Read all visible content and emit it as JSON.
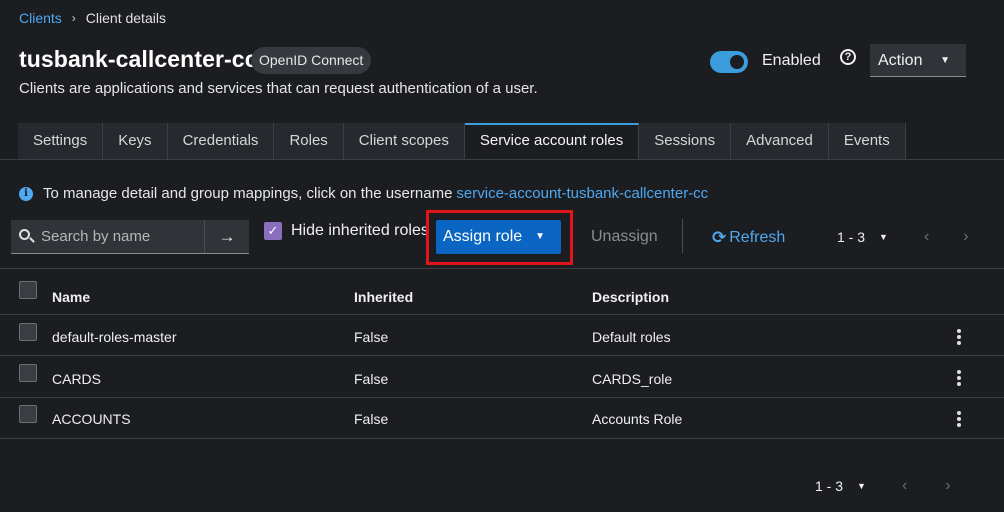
{
  "breadcrumb": {
    "root": "Clients",
    "separator": "›",
    "current": "Client details"
  },
  "header": {
    "title": "tusbank-callcenter-cc",
    "protocol_badge": "OpenID Connect",
    "subtitle": "Clients are applications and services that can request authentication of a user.",
    "enabled_label": "Enabled",
    "enabled": true,
    "help_glyph": "?",
    "action_label": "Action"
  },
  "tabs": [
    {
      "label": "Settings"
    },
    {
      "label": "Keys"
    },
    {
      "label": "Credentials"
    },
    {
      "label": "Roles"
    },
    {
      "label": "Client scopes"
    },
    {
      "label": "Service account roles",
      "active": true
    },
    {
      "label": "Sessions"
    },
    {
      "label": "Advanced"
    },
    {
      "label": "Events"
    }
  ],
  "info": {
    "text": "To manage detail and group mappings, click on the username",
    "link": "service-account-tusbank-callcenter-cc"
  },
  "toolbar": {
    "search_placeholder": "Search by name",
    "hide_inherited_label": "Hide inherited roles",
    "hide_inherited_checked": true,
    "assign_label": "Assign role",
    "unassign_label": "Unassign",
    "refresh_label": "Refresh",
    "pagination": "1 - 3"
  },
  "table": {
    "headers": {
      "name": "Name",
      "inherited": "Inherited",
      "description": "Description"
    },
    "rows": [
      {
        "name": "default-roles-master",
        "inherited": "False",
        "description": "Default roles"
      },
      {
        "name": "CARDS",
        "inherited": "False",
        "description": "CARDS_role"
      },
      {
        "name": "ACCOUNTS",
        "inherited": "False",
        "description": "Accounts Role"
      }
    ]
  },
  "footer": {
    "pagination": "1 - 3"
  },
  "colors": {
    "background": "#1b1d21",
    "link": "#4fa8f0",
    "primary_button": "#0b66c3",
    "highlight_box": "#e0141a",
    "toggle_on": "#3b9dde",
    "checkbox_checked": "#8a6fbf"
  },
  "icons": {
    "breadcrumb_separator": "chevron-right-icon",
    "help": "help-circle-icon",
    "info": "info-circle-icon",
    "search": "search-icon",
    "search_go": "arrow-right-icon",
    "refresh": "refresh-icon",
    "dropdown": "caret-down-icon",
    "prev_page": "angle-left-icon",
    "next_page": "angle-right-icon",
    "row_actions": "kebab-icon"
  }
}
